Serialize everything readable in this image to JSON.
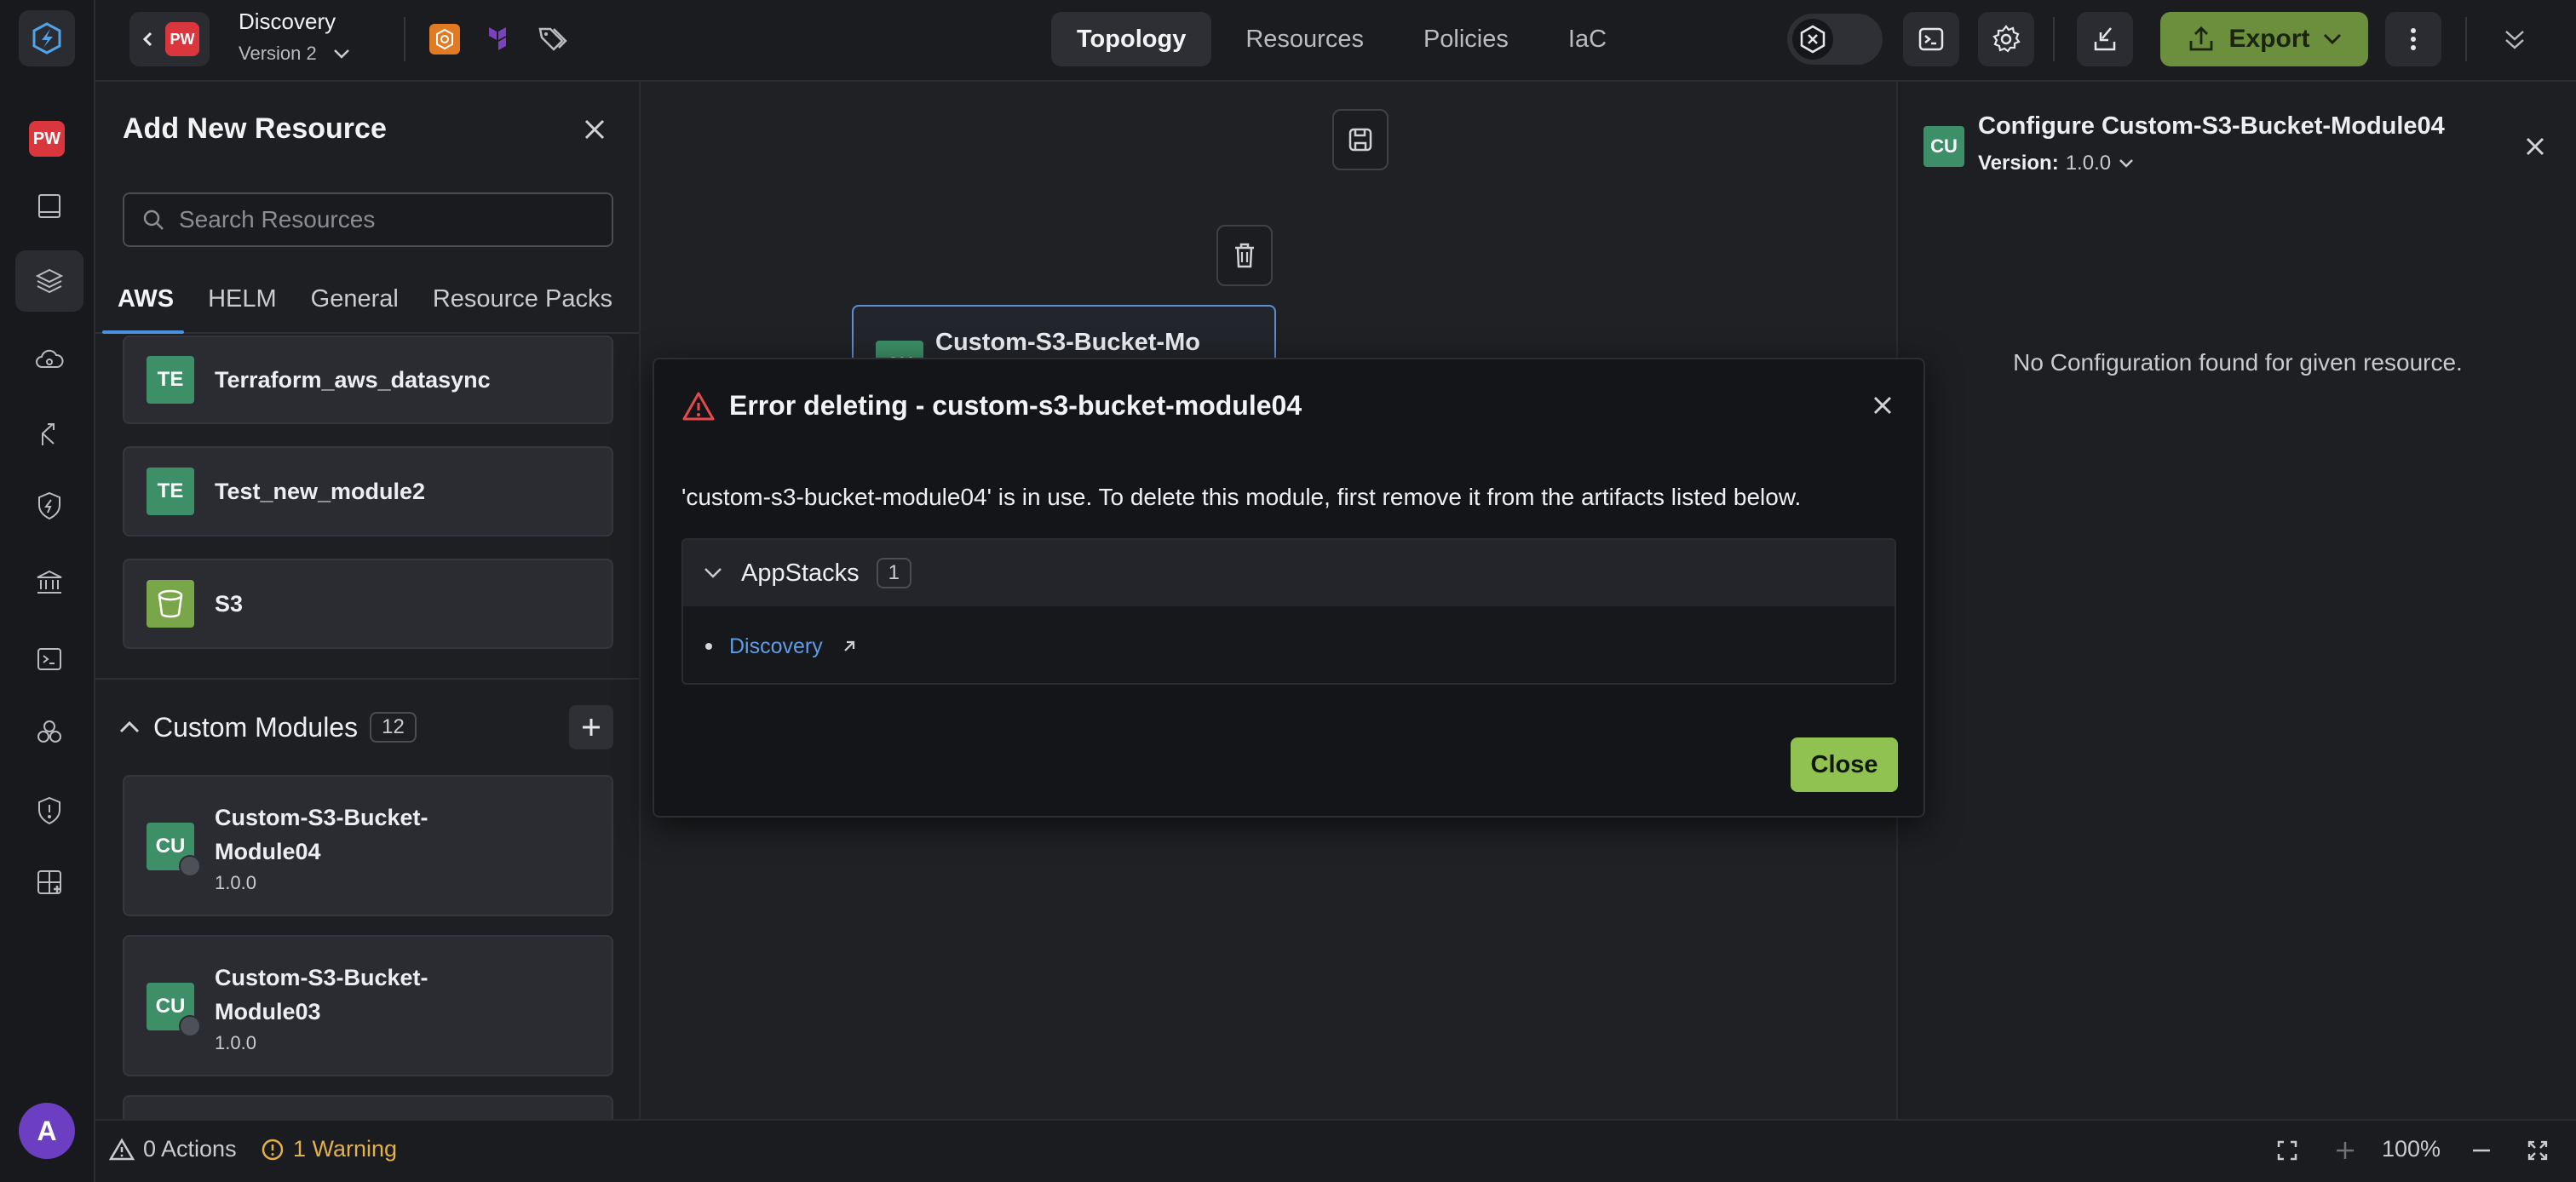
{
  "header": {
    "app_badge": "PW",
    "app_title": "Discovery",
    "version_label": "Version 2",
    "tabs": [
      {
        "label": "Topology",
        "active": true
      },
      {
        "label": "Resources",
        "active": false
      },
      {
        "label": "Policies",
        "active": false
      },
      {
        "label": "IaC",
        "active": false
      }
    ],
    "export_label": "Export",
    "icons": [
      "chevron-left-icon",
      "aws-icon",
      "terraform-icon",
      "tags-icon",
      "expression-toggle-icon",
      "terminal-icon",
      "gear-icon",
      "import-icon",
      "upload-icon",
      "kebab-icon",
      "collapse-icon"
    ]
  },
  "rail": {
    "badge": "PW",
    "avatar_initial": "A",
    "icons": [
      "logo-icon",
      "book-icon",
      "layers-icon",
      "cloud-icon",
      "branch-icon",
      "shield-bolt-icon",
      "bank-icon",
      "terminal-icon",
      "cubes-icon",
      "shield-alert-icon",
      "add-grid-icon"
    ]
  },
  "left_panel": {
    "title": "Add New Resource",
    "search_placeholder": "Search Resources",
    "tabs": [
      {
        "label": "AWS",
        "active": true
      },
      {
        "label": "HELM",
        "active": false
      },
      {
        "label": "General",
        "active": false
      },
      {
        "label": "Resource Packs",
        "active": false
      }
    ],
    "resources": [
      {
        "icon": "TE",
        "name": "Terraform_aws_datasync"
      },
      {
        "icon": "TE",
        "name": "Test_new_module2"
      },
      {
        "icon": "bucket",
        "name": "S3"
      }
    ],
    "custom_modules": {
      "title": "Custom Modules",
      "count": "12",
      "items": [
        {
          "icon": "CU",
          "name_line1": "Custom-S3-Bucket-",
          "name_line2": "Module04",
          "version": "1.0.0"
        },
        {
          "icon": "CU",
          "name_line1": "Custom-S3-Bucket-",
          "name_line2": "Module03",
          "version": "1.0.0"
        }
      ]
    }
  },
  "canvas": {
    "node": {
      "icon": "CU",
      "name": "Custom-S3-Bucket-Mo"
    }
  },
  "right_panel": {
    "icon": "CU",
    "title": "Configure Custom-S3-Bucket-Module04",
    "version_label": "Version:",
    "version_value": "1.0.0",
    "empty_message": "No Configuration found for given resource."
  },
  "modal": {
    "title": "Error deleting - custom-s3-bucket-module04",
    "message": "'custom-s3-bucket-module04' is in use. To delete this module, first remove it from the artifacts listed below.",
    "group_title": "AppStacks",
    "group_count": "1",
    "items": [
      "Discovery"
    ],
    "close_label": "Close"
  },
  "statusbar": {
    "actions": "0 Actions",
    "warnings": "1 Warning",
    "zoom": "100%"
  },
  "colors": {
    "accent_green": "#8fc250",
    "export_green": "#6b8f3c",
    "link_blue": "#5e9de6",
    "warning_amber": "#e3b04b",
    "danger_red": "#e5484d",
    "module_teal": "#3c8f66"
  }
}
